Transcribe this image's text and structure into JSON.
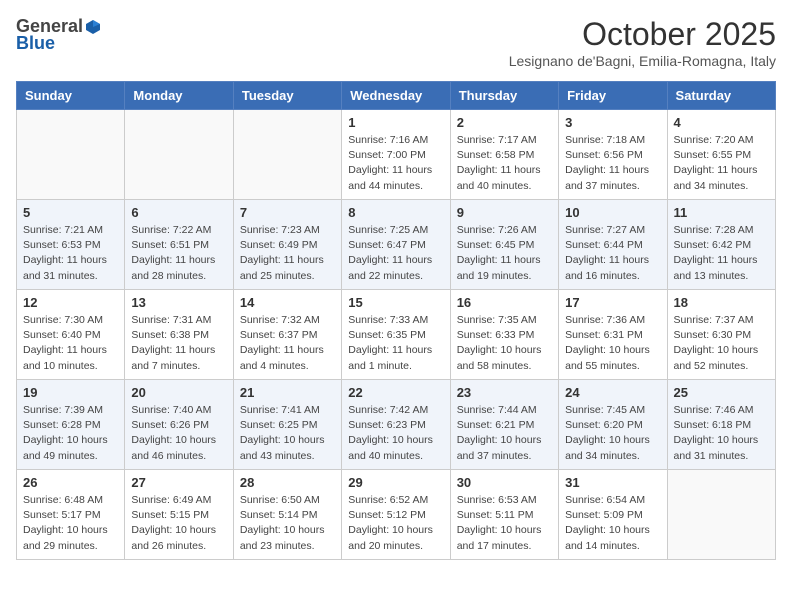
{
  "header": {
    "logo_general": "General",
    "logo_blue": "Blue",
    "month_title": "October 2025",
    "subtitle": "Lesignano de'Bagni, Emilia-Romagna, Italy"
  },
  "days_of_week": [
    "Sunday",
    "Monday",
    "Tuesday",
    "Wednesday",
    "Thursday",
    "Friday",
    "Saturday"
  ],
  "weeks": [
    [
      {
        "day": "",
        "info": ""
      },
      {
        "day": "",
        "info": ""
      },
      {
        "day": "",
        "info": ""
      },
      {
        "day": "1",
        "info": "Sunrise: 7:16 AM\nSunset: 7:00 PM\nDaylight: 11 hours\nand 44 minutes."
      },
      {
        "day": "2",
        "info": "Sunrise: 7:17 AM\nSunset: 6:58 PM\nDaylight: 11 hours\nand 40 minutes."
      },
      {
        "day": "3",
        "info": "Sunrise: 7:18 AM\nSunset: 6:56 PM\nDaylight: 11 hours\nand 37 minutes."
      },
      {
        "day": "4",
        "info": "Sunrise: 7:20 AM\nSunset: 6:55 PM\nDaylight: 11 hours\nand 34 minutes."
      }
    ],
    [
      {
        "day": "5",
        "info": "Sunrise: 7:21 AM\nSunset: 6:53 PM\nDaylight: 11 hours\nand 31 minutes."
      },
      {
        "day": "6",
        "info": "Sunrise: 7:22 AM\nSunset: 6:51 PM\nDaylight: 11 hours\nand 28 minutes."
      },
      {
        "day": "7",
        "info": "Sunrise: 7:23 AM\nSunset: 6:49 PM\nDaylight: 11 hours\nand 25 minutes."
      },
      {
        "day": "8",
        "info": "Sunrise: 7:25 AM\nSunset: 6:47 PM\nDaylight: 11 hours\nand 22 minutes."
      },
      {
        "day": "9",
        "info": "Sunrise: 7:26 AM\nSunset: 6:45 PM\nDaylight: 11 hours\nand 19 minutes."
      },
      {
        "day": "10",
        "info": "Sunrise: 7:27 AM\nSunset: 6:44 PM\nDaylight: 11 hours\nand 16 minutes."
      },
      {
        "day": "11",
        "info": "Sunrise: 7:28 AM\nSunset: 6:42 PM\nDaylight: 11 hours\nand 13 minutes."
      }
    ],
    [
      {
        "day": "12",
        "info": "Sunrise: 7:30 AM\nSunset: 6:40 PM\nDaylight: 11 hours\nand 10 minutes."
      },
      {
        "day": "13",
        "info": "Sunrise: 7:31 AM\nSunset: 6:38 PM\nDaylight: 11 hours\nand 7 minutes."
      },
      {
        "day": "14",
        "info": "Sunrise: 7:32 AM\nSunset: 6:37 PM\nDaylight: 11 hours\nand 4 minutes."
      },
      {
        "day": "15",
        "info": "Sunrise: 7:33 AM\nSunset: 6:35 PM\nDaylight: 11 hours\nand 1 minute."
      },
      {
        "day": "16",
        "info": "Sunrise: 7:35 AM\nSunset: 6:33 PM\nDaylight: 10 hours\nand 58 minutes."
      },
      {
        "day": "17",
        "info": "Sunrise: 7:36 AM\nSunset: 6:31 PM\nDaylight: 10 hours\nand 55 minutes."
      },
      {
        "day": "18",
        "info": "Sunrise: 7:37 AM\nSunset: 6:30 PM\nDaylight: 10 hours\nand 52 minutes."
      }
    ],
    [
      {
        "day": "19",
        "info": "Sunrise: 7:39 AM\nSunset: 6:28 PM\nDaylight: 10 hours\nand 49 minutes."
      },
      {
        "day": "20",
        "info": "Sunrise: 7:40 AM\nSunset: 6:26 PM\nDaylight: 10 hours\nand 46 minutes."
      },
      {
        "day": "21",
        "info": "Sunrise: 7:41 AM\nSunset: 6:25 PM\nDaylight: 10 hours\nand 43 minutes."
      },
      {
        "day": "22",
        "info": "Sunrise: 7:42 AM\nSunset: 6:23 PM\nDaylight: 10 hours\nand 40 minutes."
      },
      {
        "day": "23",
        "info": "Sunrise: 7:44 AM\nSunset: 6:21 PM\nDaylight: 10 hours\nand 37 minutes."
      },
      {
        "day": "24",
        "info": "Sunrise: 7:45 AM\nSunset: 6:20 PM\nDaylight: 10 hours\nand 34 minutes."
      },
      {
        "day": "25",
        "info": "Sunrise: 7:46 AM\nSunset: 6:18 PM\nDaylight: 10 hours\nand 31 minutes."
      }
    ],
    [
      {
        "day": "26",
        "info": "Sunrise: 6:48 AM\nSunset: 5:17 PM\nDaylight: 10 hours\nand 29 minutes."
      },
      {
        "day": "27",
        "info": "Sunrise: 6:49 AM\nSunset: 5:15 PM\nDaylight: 10 hours\nand 26 minutes."
      },
      {
        "day": "28",
        "info": "Sunrise: 6:50 AM\nSunset: 5:14 PM\nDaylight: 10 hours\nand 23 minutes."
      },
      {
        "day": "29",
        "info": "Sunrise: 6:52 AM\nSunset: 5:12 PM\nDaylight: 10 hours\nand 20 minutes."
      },
      {
        "day": "30",
        "info": "Sunrise: 6:53 AM\nSunset: 5:11 PM\nDaylight: 10 hours\nand 17 minutes."
      },
      {
        "day": "31",
        "info": "Sunrise: 6:54 AM\nSunset: 5:09 PM\nDaylight: 10 hours\nand 14 minutes."
      },
      {
        "day": "",
        "info": ""
      }
    ]
  ]
}
